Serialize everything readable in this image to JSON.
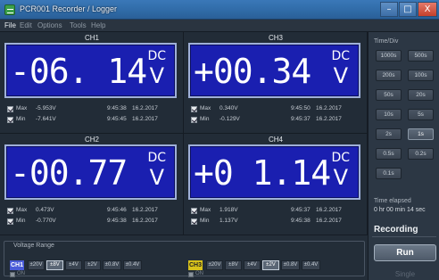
{
  "window": {
    "title": "PCR001 Recorder / Logger",
    "controls": {
      "minimize": "–",
      "maximize": "□",
      "close": "X"
    }
  },
  "menu": [
    "File",
    "Edit",
    "Options",
    "Tools",
    "Help"
  ],
  "channels": [
    {
      "name": "CH1",
      "reading": "-06. 14",
      "coupling": "DC",
      "unit": "V",
      "max": {
        "label": "Max",
        "value": "-5.953V",
        "time": "9:45:38",
        "date": "16.2.2017"
      },
      "min": {
        "label": "Min",
        "value": "-7.641V",
        "time": "9:45:45",
        "date": "16.2.2017"
      }
    },
    {
      "name": "CH3",
      "reading": "+00.34",
      "coupling": "DC",
      "unit": "V",
      "max": {
        "label": "Max",
        "value": "0.340V",
        "time": "9:45:50",
        "date": "16.2.2017"
      },
      "min": {
        "label": "Min",
        "value": "-0.129V",
        "time": "9:45:37",
        "date": "16.2.2017"
      }
    },
    {
      "name": "CH2",
      "reading": "-00.77",
      "coupling": "DC",
      "unit": "V",
      "max": {
        "label": "Max",
        "value": "0.473V",
        "time": "9:45:46",
        "date": "16.2.2017"
      },
      "min": {
        "label": "Min",
        "value": "-0.770V",
        "time": "9:45:38",
        "date": "16.2.2017"
      }
    },
    {
      "name": "CH4",
      "reading": "+0 1.14",
      "coupling": "DC",
      "unit": "V",
      "max": {
        "label": "Max",
        "value": "1.918V",
        "time": "9:45:37",
        "date": "16.2.2017"
      },
      "min": {
        "label": "Min",
        "value": "1.137V",
        "time": "9:45:38",
        "date": "16.2.2017"
      }
    }
  ],
  "timediv": {
    "label": "Time/Div",
    "options": [
      "1000s",
      "500s",
      "200s",
      "100s",
      "50s",
      "20s",
      "10s",
      "5s",
      "2s",
      "1s",
      "0.5s",
      "0.2s",
      "0.1s"
    ],
    "selected": "1s"
  },
  "elapsed": {
    "label": "Time elapsed",
    "value": "0 hr 00 min 14 sec"
  },
  "status": "Recording",
  "buttons": {
    "run": "Run",
    "single": "Single"
  },
  "voltage_range": {
    "label": "Voltage Range",
    "groups": [
      {
        "channel": "CH1",
        "color": "#4a5cd8",
        "options": [
          "±20V",
          "±8V",
          "±4V",
          "±2V",
          "±0.8V",
          "±0.4V"
        ],
        "selected": "±8V",
        "on_label": "ON"
      },
      {
        "channel": "CH3",
        "color": "#d8c21a",
        "options": [
          "±20V",
          "±8V",
          "±4V",
          "±2V",
          "±0.8V",
          "±0.4V"
        ],
        "selected": "±2V",
        "on_label": "ON"
      }
    ]
  }
}
